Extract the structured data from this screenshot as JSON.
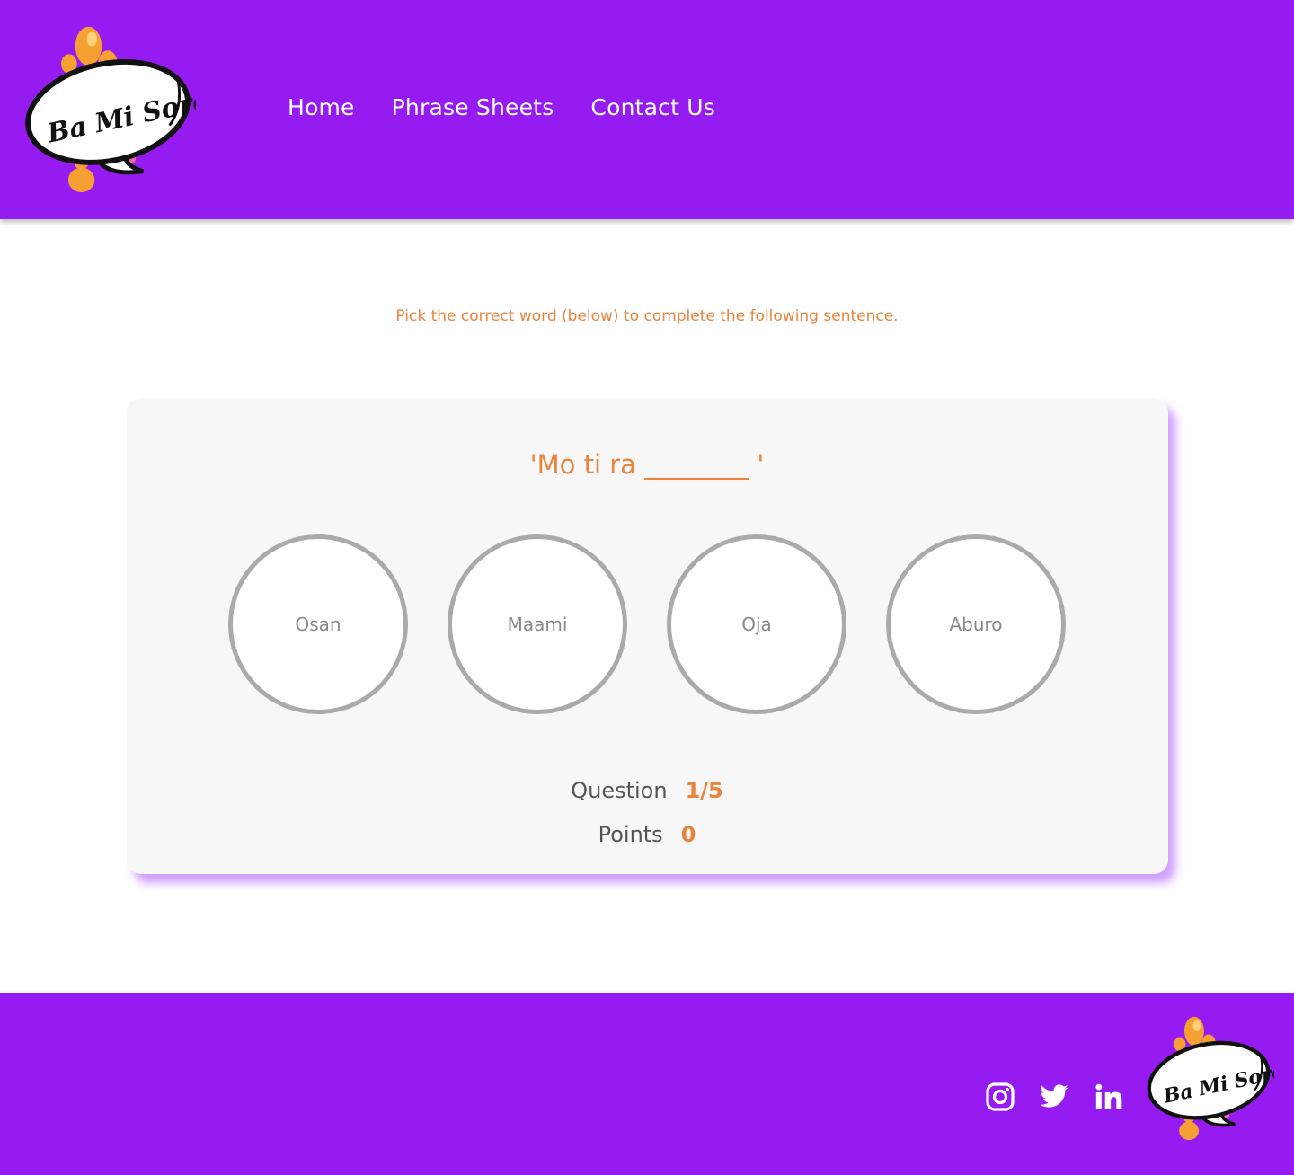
{
  "brand": {
    "logo_text": "Ba Mi Soro!",
    "colors": {
      "purple": "#951bf0",
      "orange": "#e8843c",
      "gray_ring": "#aaaaaa"
    }
  },
  "nav": {
    "items": [
      {
        "label": "Home"
      },
      {
        "label": "Phrase Sheets"
      },
      {
        "label": "Contact Us"
      }
    ]
  },
  "quiz": {
    "instruction": "Pick the correct word (below) to complete the following sentence.",
    "sentence": "'Mo ti ra ________ '",
    "options": [
      "Osan",
      "Maami",
      "Oja",
      "Aburo"
    ],
    "question_label": "Question",
    "question_value": "1/5",
    "points_label": "Points",
    "points_value": "0"
  },
  "footer": {
    "social": [
      {
        "icon": "instagram-icon"
      },
      {
        "icon": "twitter-icon"
      },
      {
        "icon": "linkedin-icon"
      }
    ]
  }
}
